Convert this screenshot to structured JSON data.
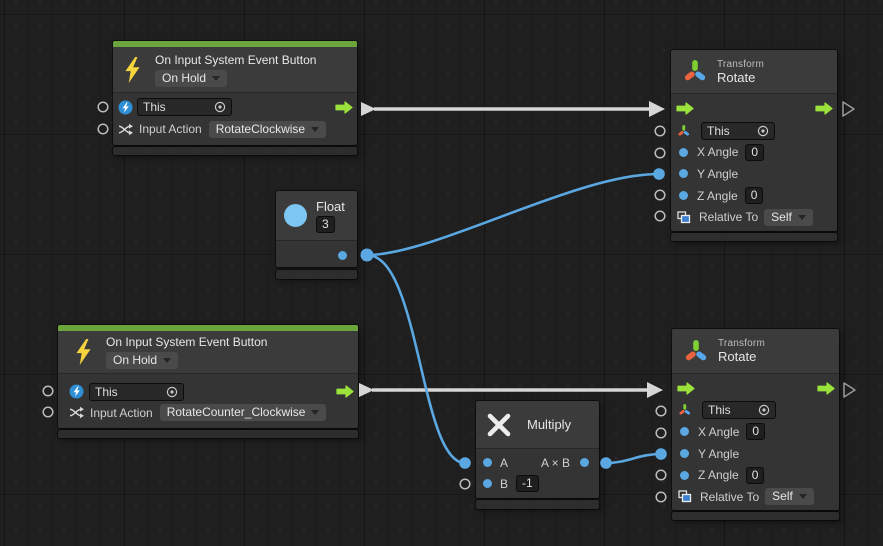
{
  "graph": {
    "colors": {
      "event_accent_bar": "#6ca53c",
      "control_port_green": "#9be23b",
      "value_port_blue": "#5aa7e2",
      "control_wire_white": "#d6d6d6",
      "node_header_bg": "#3b3b3b",
      "node_body_bg": "#343434"
    },
    "nodes": {
      "event1": {
        "title": "On Input System Event Button",
        "mode": "On Hold",
        "this_value": "This",
        "input_action_label": "Input Action",
        "input_action_value": "RotateClockwise"
      },
      "event2": {
        "title": "On Input System Event Button",
        "mode": "On Hold",
        "this_value": "This",
        "input_action_label": "Input Action",
        "input_action_value": "RotateCounter_Clockwise"
      },
      "rotate1": {
        "category": "Transform",
        "title": "Rotate",
        "this_value": "This",
        "x_label": "X Angle",
        "x_value": "0",
        "y_label": "Y Angle",
        "z_label": "Z Angle",
        "z_value": "0",
        "relative_label": "Relative To",
        "relative_value": "Self"
      },
      "rotate2": {
        "category": "Transform",
        "title": "Rotate",
        "this_value": "This",
        "x_label": "X Angle",
        "x_value": "0",
        "y_label": "Y Angle",
        "z_label": "Z Angle",
        "z_value": "0",
        "relative_label": "Relative To",
        "relative_value": "Self"
      },
      "float1": {
        "title": "Float",
        "value": "3"
      },
      "multiply": {
        "title": "Multiply",
        "a_label": "A",
        "b_label": "B",
        "b_value": "-1",
        "output_label": "A × B"
      }
    }
  }
}
